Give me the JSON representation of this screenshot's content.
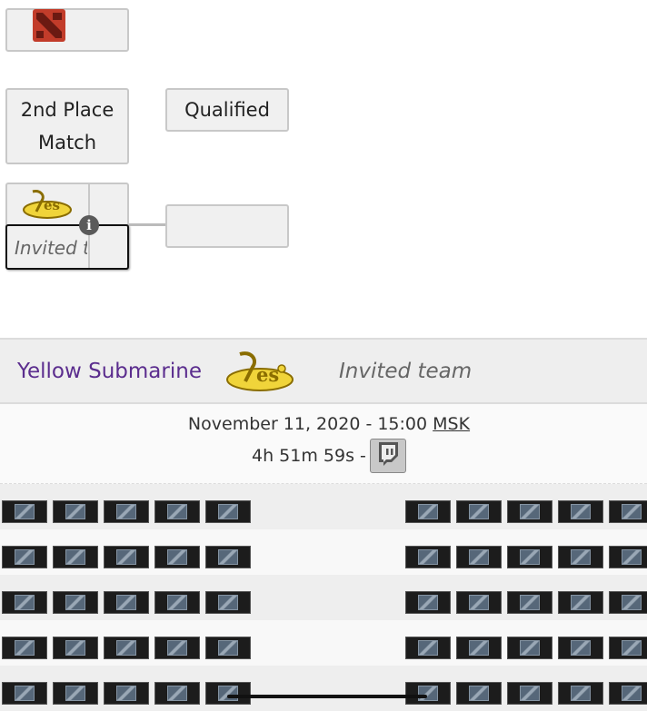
{
  "bracket": {
    "game_icon": "dota2-logo-icon",
    "round_headers": [
      "2nd Place\nMatch",
      "Qualified"
    ],
    "round_1_label_line1": "2nd Place",
    "round_1_label_line2": "Match",
    "round_2_label": "Qualified",
    "match": {
      "top_team_logo": "yellow-submarine-logo",
      "bottom_team_name": "Invited team",
      "info_icon": "info-icon"
    }
  },
  "match_detail": {
    "team1_name": "Yellow Submarine",
    "team1_logo": "yellow-submarine-logo",
    "team2_name": "Invited team",
    "date": "November 11, 2020 - 15:00",
    "timezone": "MSK",
    "countdown": "4h 51m 59s -",
    "stream_icon": "twitch-icon"
  },
  "picks": {
    "rows": 5,
    "left_icons_per_row": 5,
    "right_icons_per_row": 5,
    "placeholder_icon": "dota2-hero-placeholder-icon"
  },
  "colors": {
    "team_link": "#5b2d8e",
    "dota_red": "#c23c2a",
    "ys_yellow": "#f0d43a"
  }
}
